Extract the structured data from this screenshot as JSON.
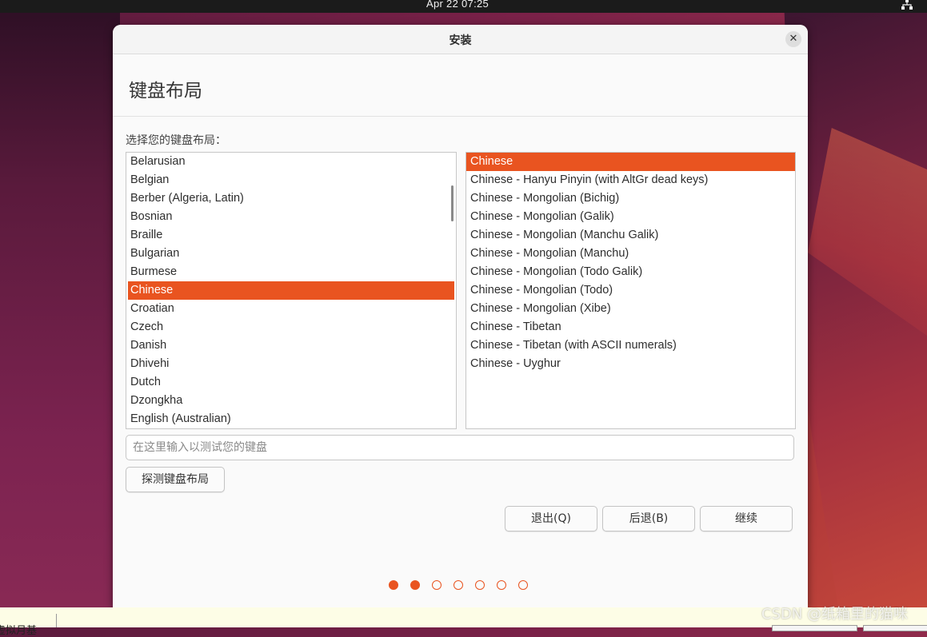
{
  "topbar": {
    "clock": "Apr 22  07:25"
  },
  "window": {
    "title": "安装",
    "close_symbol": "✕"
  },
  "page": {
    "title": "键盘布局",
    "prompt": "选择您的键盘布局："
  },
  "layouts": {
    "items": [
      "Belarusian",
      "Belgian",
      "Berber (Algeria, Latin)",
      "Bosnian",
      "Braille",
      "Bulgarian",
      "Burmese",
      "Chinese",
      "Croatian",
      "Czech",
      "Danish",
      "Dhivehi",
      "Dutch",
      "Dzongkha",
      "English (Australian)"
    ],
    "selected": "Chinese"
  },
  "variants": {
    "items": [
      "Chinese",
      "Chinese - Hanyu Pinyin (with AltGr dead keys)",
      "Chinese - Mongolian (Bichig)",
      "Chinese - Mongolian (Galik)",
      "Chinese - Mongolian (Manchu Galik)",
      "Chinese - Mongolian (Manchu)",
      "Chinese - Mongolian (Todo Galik)",
      "Chinese - Mongolian (Todo)",
      "Chinese - Mongolian (Xibe)",
      "Chinese - Tibetan",
      "Chinese - Tibetan (with ASCII numerals)",
      "Chinese - Uyghur"
    ],
    "selected": "Chinese"
  },
  "test_input": {
    "placeholder": "在这里输入以测试您的键盘",
    "value": ""
  },
  "buttons": {
    "detect": "探测键盘布局",
    "quit": "退出(Q)",
    "back": "后退(B)",
    "continue": "继续"
  },
  "progress": {
    "total_steps": 7,
    "current_step": 2
  },
  "colors": {
    "accent": "#e95420",
    "window_bg": "#fafafa"
  },
  "footer": {
    "left_text": "虚拟月基"
  },
  "watermark": "CSDN @纸箱里的猫咪",
  "icons": {
    "network": "network-icon",
    "close": "close-icon"
  }
}
